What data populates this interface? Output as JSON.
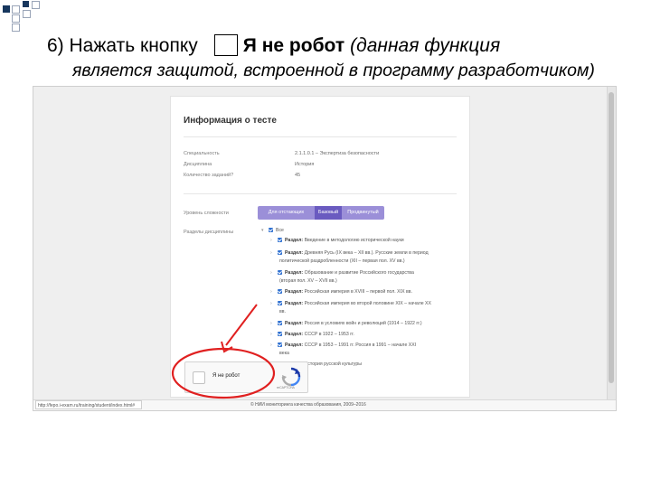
{
  "slide": {
    "step_text": "6) Нажать кнопку",
    "button_name": "Я не робот",
    "note_line1": "(данная функция",
    "note_line2": "является защитой, встроенной в программу разработчиком)"
  },
  "card": {
    "title": "Информация о тесте",
    "fields": [
      {
        "label": "Специальность",
        "value": "2.1.1.0.1 – Экспертиза безопасности"
      },
      {
        "label": "Дисциплина",
        "value": "История"
      },
      {
        "label": "Количество заданий?",
        "value": "45"
      }
    ],
    "level_label": "Уровень сложности",
    "levels": [
      "Для отстающих",
      "Базовый",
      "Продвинутый"
    ],
    "levels_active_index": 1,
    "sections_label": "Разделы дисциплины",
    "tree": {
      "all": "Все",
      "section_prefix": "Раздел:",
      "items": [
        {
          "text": "Введение в методологию исторической науки",
          "cont": ""
        },
        {
          "text": "Древняя Русь (IX века – XII вв.). Русские земли в период",
          "cont": "политической раздробленности (XII – первая пол. XV вв.)"
        },
        {
          "text": "Образование и развитие Российского государства",
          "cont": "(вторая пол. XV – XVII вв.)"
        },
        {
          "text": "Российская империя в XVIII – первой пол. XIX вв.",
          "cont": ""
        },
        {
          "text": "Российская империя во второй половине XIX – начале XX",
          "cont": "вв."
        },
        {
          "text": "Россия в условиях войн и революций (1914 – 1922 гг.)",
          "cont": ""
        },
        {
          "text": "СССР в 1922 – 1953 гг.",
          "cont": ""
        },
        {
          "text": "СССР в 1953 – 1991 гг. Россия в 1991 – начале XXI",
          "cont": "века"
        },
        {
          "text": "История русской культуры",
          "cont": ""
        }
      ]
    }
  },
  "recaptcha": {
    "label": "Я не робот",
    "brand": "reCAPTCHA",
    "terms": "Конфиденциальность – Условия использования"
  },
  "statusbar": {
    "url": "http://fepo.i-exam.ru/training/student/index.html#",
    "copyright": "© НИИ мониторинга качества образования, 2009–2016"
  },
  "colors": {
    "segment_active": "#6a5bc0",
    "segment_inactive": "#9b8fd8",
    "checkbox_blue": "#2d6fd0",
    "annotation_red": "#e02020"
  }
}
